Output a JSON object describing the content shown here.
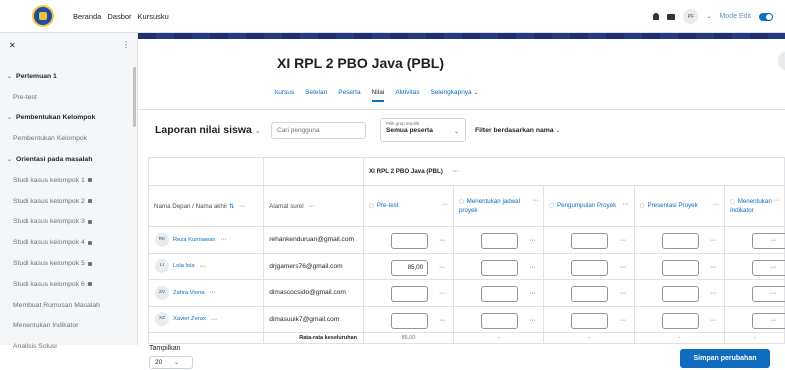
{
  "navbar": {
    "links": [
      "Beranda",
      "Dasbor",
      "Kursusku"
    ],
    "avatar_initials": "PF",
    "mode_edit_label": "Mode Edit"
  },
  "sidebar": {
    "items": [
      {
        "label": "Pertemuan 1",
        "kind": "section",
        "locked": false
      },
      {
        "label": "Pre-test",
        "kind": "item",
        "locked": false
      },
      {
        "label": "Pembentukan Kelompok",
        "kind": "section",
        "locked": false
      },
      {
        "label": "Pembentukan Kelompok",
        "kind": "item",
        "locked": false
      },
      {
        "label": "Orientasi pada masalah",
        "kind": "section",
        "locked": false
      },
      {
        "label": "Studi kasus kelompok 1",
        "kind": "item",
        "locked": true
      },
      {
        "label": "Studi kasus kelompok 2",
        "kind": "item",
        "locked": true
      },
      {
        "label": "Studi kasus kelompok 3",
        "kind": "item",
        "locked": true
      },
      {
        "label": "Studi kasus kelompok 4",
        "kind": "item",
        "locked": true
      },
      {
        "label": "Studi kasus kelompok 5",
        "kind": "item",
        "locked": true
      },
      {
        "label": "Studi kasus kelompok 6",
        "kind": "item",
        "locked": true
      },
      {
        "label": "Membuat Rumusan Masalah",
        "kind": "item",
        "locked": false
      },
      {
        "label": "Menentukan Indikator",
        "kind": "item",
        "locked": false
      },
      {
        "label": "Analisis Solusi",
        "kind": "item",
        "locked": false
      }
    ]
  },
  "course": {
    "title": "XI RPL 2 PBO Java (PBL)",
    "nav": [
      "kursus",
      "Setelan",
      "Peserta",
      "Nilai",
      "Aktivitas",
      "Selengkapnya"
    ],
    "active_nav": "Nilai"
  },
  "report": {
    "title": "Laporan nilai siswa",
    "search_placeholder": "Cari pengguna",
    "group_label": "Pilih grup terpilih",
    "group_value": "Semua peserta",
    "filter_name": "Filter berdasarkan nama"
  },
  "grid": {
    "course_category": "XI RPL 2 PBO Java (PBL)",
    "name_header": "Nama Depan / Nama akhir",
    "email_header": "Alamat surel",
    "grade_items": [
      "Pre-test",
      "Menentukan jadwal proyek",
      "Pengumpulan Proyek",
      "Presentasi Proyek",
      "Menentukan Indikator"
    ],
    "rows": [
      {
        "initials": "RK",
        "name": "Reza Kurniawan",
        "email": "rehankenduruan@gmail.com",
        "grades": [
          "",
          "",
          "",
          "",
          ""
        ]
      },
      {
        "initials": "LI",
        "name": "Lola lola",
        "email": "drjgamers76@gmail.com",
        "grades": [
          "85,00",
          "",
          "",
          "",
          ""
        ]
      },
      {
        "initials": "ZV",
        "name": "Zahra Viona",
        "email": "dimascocsido@gmail.com",
        "grades": [
          "",
          "",
          "",
          "",
          ""
        ]
      },
      {
        "initials": "XZ",
        "name": "Xavier Zerax",
        "email": "dimasuuik7@gmail.com",
        "grades": [
          "",
          "",
          "",
          "",
          ""
        ]
      }
    ],
    "average_label": "Rata-rata keseluruhan",
    "averages": [
      "85,00",
      "-",
      "-",
      "-",
      "-"
    ]
  },
  "footer": {
    "per_page_label": "Tampilkan",
    "per_page_value": "20",
    "save_label": "Simpan perubahan"
  }
}
